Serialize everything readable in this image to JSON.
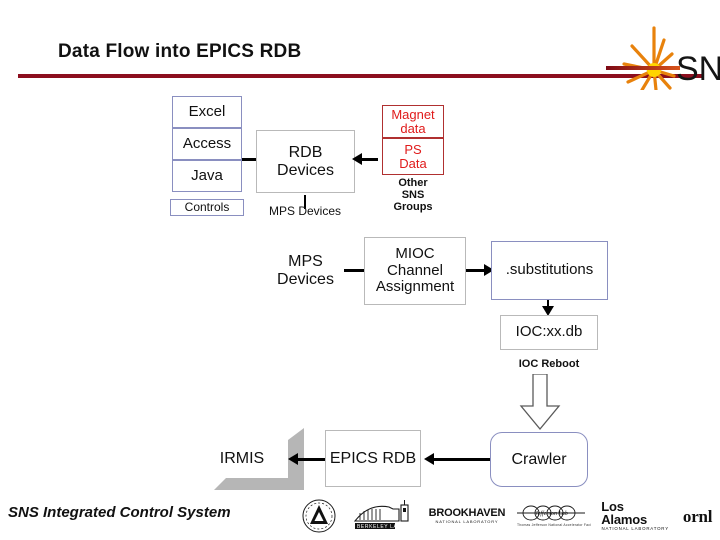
{
  "slide": {
    "title": "Data Flow into EPICS RDB",
    "rule_color": "#8C0E1E",
    "background": "#ffffff"
  },
  "logo": {
    "name": "sns-logo",
    "text": "SNS",
    "burst_color": "#F0A500",
    "beam_color": "#8C0E1E"
  },
  "diagram": {
    "sources_stack": {
      "items": [
        {
          "label": "Excel"
        },
        {
          "label": "Access"
        },
        {
          "label": "Java"
        }
      ],
      "border_color": "#8a8fc0"
    },
    "controls_box": {
      "label": "Controls"
    },
    "rdb_devices_box": {
      "label": "RDB\nDevices"
    },
    "rdb_devices_caption": "MPS Devices",
    "magnet_box": {
      "line1": "Magnet",
      "line2": "data",
      "line3": "PS",
      "line4": "Data",
      "text_color": "#e01b1b"
    },
    "other_sns_groups": {
      "line1": "Other",
      "line2": "SNS",
      "line3": "Groups",
      "text_color": "#e01b1b"
    },
    "mps_devices_box": {
      "label": "MPS\nDevices"
    },
    "mioc_box": {
      "label": "MIOC\nChannel\nAssignment"
    },
    "substitutions_box": {
      "label": ".substitutions"
    },
    "ioc_db_box": {
      "label": "IOC:xx.db"
    },
    "ioc_reboot_label": "IOC Reboot",
    "crawler_box": {
      "label": "Crawler"
    },
    "epics_rdb_box": {
      "label": "EPICS RDB"
    },
    "irmis_box": {
      "label": "IRMIS"
    }
  },
  "footer": {
    "text": "SNS Integrated Control System",
    "logos": [
      {
        "name": "argonne-logo",
        "text": "A",
        "sub": "ARGONNE NATIONAL LABORATORY"
      },
      {
        "name": "berkeley-lab-logo",
        "text": "BERKELEY LAB",
        "sub": ""
      },
      {
        "name": "brookhaven-logo",
        "text": "BROOKHAVEN",
        "sub": "NATIONAL LABORATORY"
      },
      {
        "name": "jefferson-lab-logo",
        "text": "Jefferson Lab",
        "sub": "Thomas Jefferson National Accelerator Facility"
      },
      {
        "name": "los-alamos-logo",
        "text": "Los Alamos",
        "sub": "NATIONAL LABORATORY"
      },
      {
        "name": "ornl-logo",
        "text": "ornl",
        "sub": ""
      }
    ]
  }
}
